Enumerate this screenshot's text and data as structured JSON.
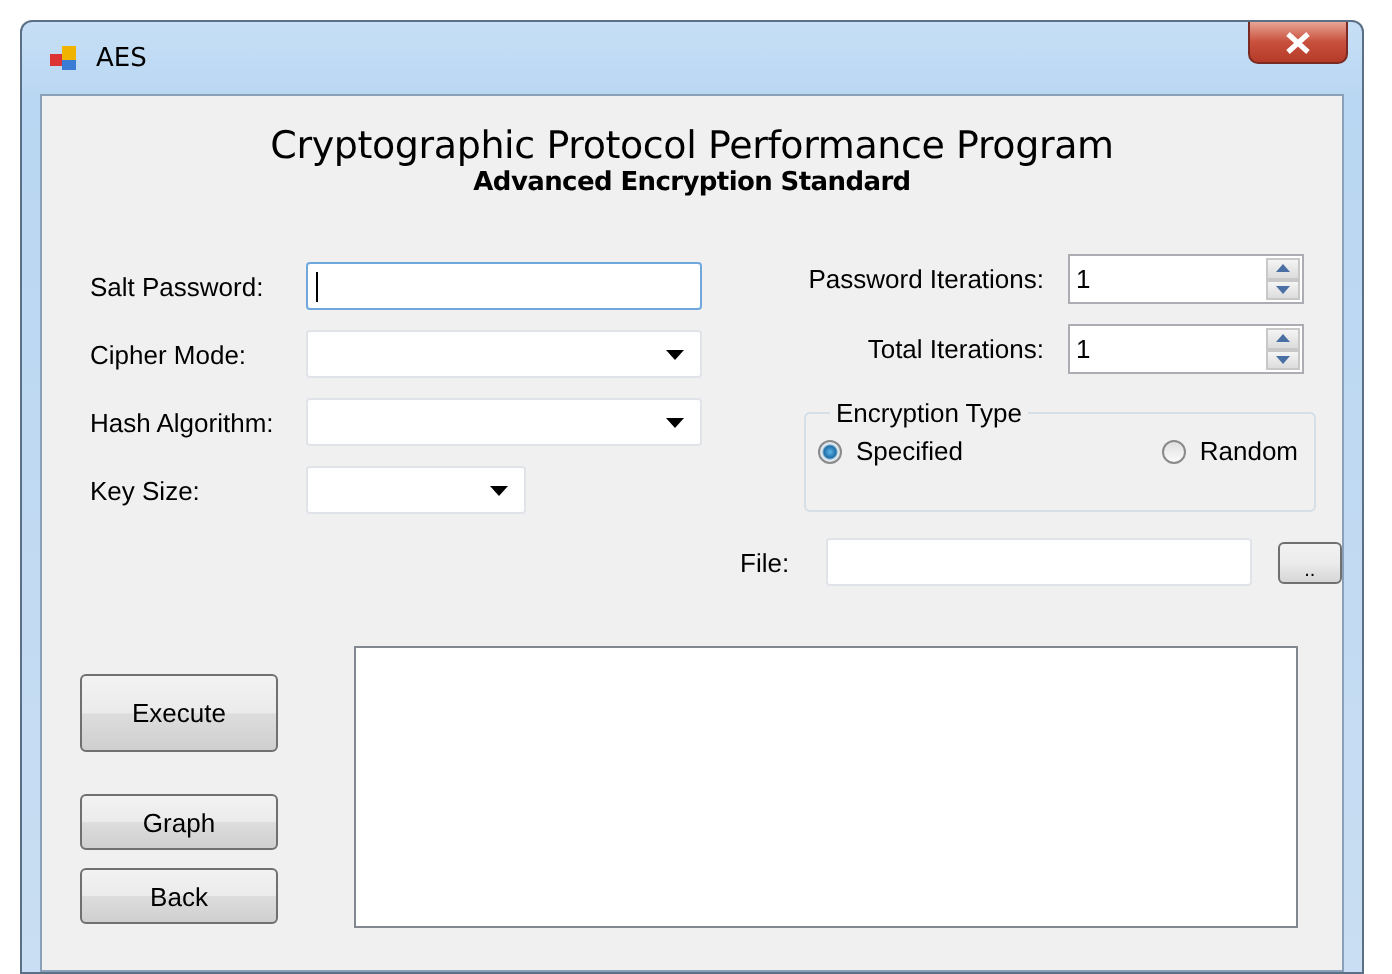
{
  "window": {
    "title": "AES"
  },
  "header": {
    "title": "Cryptographic Protocol Performance Program",
    "subtitle": "Advanced Encryption Standard"
  },
  "left_fields": [
    {
      "label": "Salt Password:",
      "kind": "text",
      "focused": true
    },
    {
      "label": "Cipher Mode:",
      "kind": "select"
    },
    {
      "label": "Hash Algorithm:",
      "kind": "select"
    },
    {
      "label": "Key Size:",
      "kind": "select"
    }
  ],
  "right_fields": [
    {
      "label": "Password Iterations:",
      "kind": "spinner",
      "value": "1"
    },
    {
      "label": "Total Iterations:",
      "kind": "spinner",
      "value": "1"
    }
  ],
  "encryption_type": {
    "legend": "Encryption Type",
    "options": [
      {
        "label": "Specified",
        "selected": true
      },
      {
        "label": "Random",
        "selected": false
      }
    ]
  },
  "file": {
    "label": "File:",
    "browse": ".."
  },
  "buttons": [
    {
      "label": "Execute"
    },
    {
      "label": "Graph"
    },
    {
      "label": "Back"
    }
  ]
}
